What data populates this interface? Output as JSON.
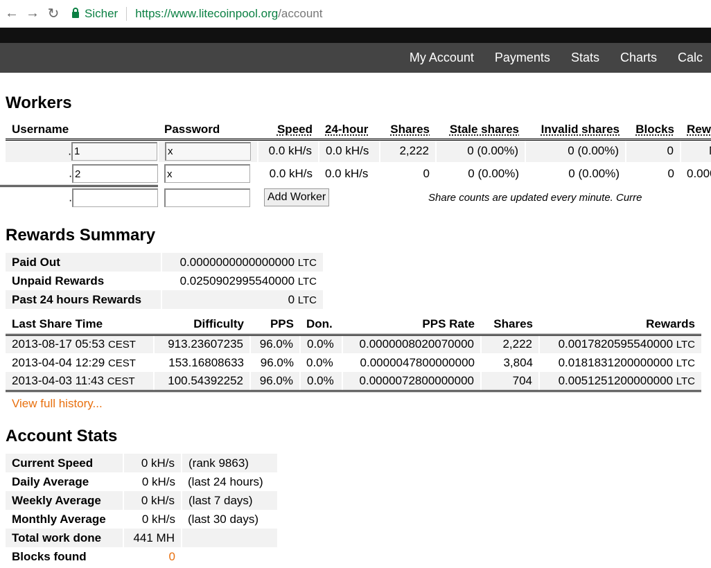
{
  "browser": {
    "secure_label": "Sicher",
    "url_scheme": "https://www.litecoinpool.org",
    "url_path": "/account"
  },
  "nav": {
    "items": [
      "My Account",
      "Payments",
      "Stats",
      "Charts",
      "Calc"
    ]
  },
  "workers": {
    "title": "Workers",
    "columns": [
      "Username",
      "Password",
      "Speed",
      "24-hour",
      "Shares",
      "Stale shares",
      "Invalid shares",
      "Blocks",
      "Rewar"
    ],
    "rows": [
      {
        "prefix": ".",
        "username": "1",
        "password": "x",
        "speed": "0.0 kH/s",
        "day": "0.0 kH/s",
        "shares": "2,222",
        "stale": "0 (0.00%)",
        "invalid": "0 (0.00%)",
        "blocks": "0",
        "rewards": "N"
      },
      {
        "prefix": ".",
        "username": "2",
        "password": "x",
        "speed": "0.0 kH/s",
        "day": "0.0 kH/s",
        "shares": "0",
        "stale": "0 (0.00%)",
        "invalid": "0 (0.00%)",
        "blocks": "0",
        "rewards": "0.000"
      }
    ],
    "new_prefix": ".",
    "add_label": "Add Worker",
    "note": "Share counts are updated every minute. Curre"
  },
  "rewards": {
    "title": "Rewards Summary",
    "unit": "LTC",
    "summary": [
      {
        "label": "Paid Out",
        "value": "0.0000000000000000"
      },
      {
        "label": "Unpaid Rewards",
        "value": "0.0250902995540000"
      },
      {
        "label": "Past 24 hours Rewards",
        "value": "0"
      }
    ],
    "columns": [
      "Last Share Time",
      "Difficulty",
      "PPS",
      "Don.",
      "PPS Rate",
      "Shares",
      "Rewards"
    ],
    "tz": "CEST",
    "rows": [
      {
        "time": "2013-08-17 05:53",
        "difficulty": "913.23607235",
        "pps": "96.0%",
        "don": "0.0%",
        "rate": "0.0000008020070000",
        "shares": "2,222",
        "rewards": "0.0017820595540000"
      },
      {
        "time": "2013-04-04 12:29",
        "difficulty": "153.16808633",
        "pps": "96.0%",
        "don": "0.0%",
        "rate": "0.0000047800000000",
        "shares": "3,804",
        "rewards": "0.0181831200000000"
      },
      {
        "time": "2013-04-03 11:43",
        "difficulty": "100.54392252",
        "pps": "96.0%",
        "don": "0.0%",
        "rate": "0.0000072800000000",
        "shares": "704",
        "rewards": "0.0051251200000000"
      }
    ],
    "history_link": "View full history..."
  },
  "stats": {
    "title": "Account Stats",
    "rows": [
      {
        "label": "Current Speed",
        "value": "0 kH/s",
        "note": "(rank 9863)"
      },
      {
        "label": "Daily Average",
        "value": "0 kH/s",
        "note": "(last 24 hours)"
      },
      {
        "label": "Weekly Average",
        "value": "0 kH/s",
        "note": "(last 7 days)"
      },
      {
        "label": "Monthly Average",
        "value": "0 kH/s",
        "note": "(last 30 days)"
      },
      {
        "label": "Total work done",
        "value": "441 MH",
        "note": ""
      },
      {
        "label": "Blocks found",
        "value": "0",
        "note": ""
      }
    ]
  },
  "colors": {
    "accent": "#e8700f",
    "nav_bg": "#444444",
    "secure": "#0b8043"
  }
}
